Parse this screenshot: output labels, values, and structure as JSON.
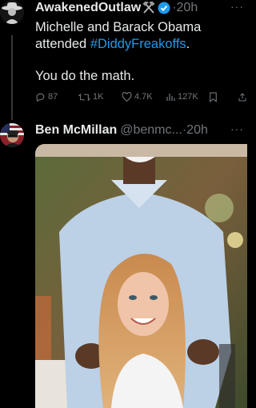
{
  "tweets": [
    {
      "author_name": "AwakenedOutlaw",
      "author_badge_icon": "crossed-hammers-icon",
      "verified_icon": "verified-badge-icon",
      "separator": "·",
      "time": "20h",
      "more_label": "···",
      "text_line1": "Michelle and Barack Obama",
      "text_line2_prefix": "attended ",
      "hashtag": "#DiddyFreakoffs",
      "text_line2_suffix": ".",
      "text_line3": "You do the math.",
      "stats": {
        "replies": "87",
        "reposts": "1K",
        "likes": "4.7K",
        "views": "127K"
      }
    },
    {
      "author_name": "Ben McMillan",
      "handle": "@benmc...",
      "separator": "·",
      "time": "20h",
      "more_label": "···"
    }
  ],
  "colors": {
    "background": "#000000",
    "text": "#e7e9ea",
    "muted": "#71767b",
    "link": "#1d9bf0",
    "verified": "#1d9bf0",
    "thread_line": "#333639"
  }
}
